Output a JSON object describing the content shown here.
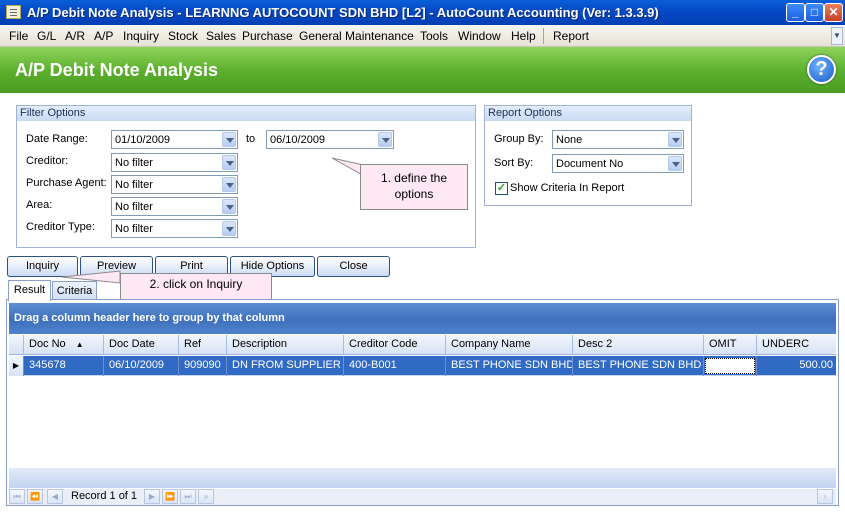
{
  "window": {
    "title": "A/P Debit Note Analysis - LEARNNG AUTOCOUNT SDN BHD [L2] - AutoCount Accounting (Ver: 1.3.3.9)",
    "minimize_glyph": "_",
    "maximize_glyph": "□",
    "close_glyph": "✕"
  },
  "menu": {
    "items": [
      "File",
      "G/L",
      "A/R",
      "A/P",
      "Inquiry",
      "Stock",
      "Sales",
      "Purchase",
      "General Maintenance",
      "Tools",
      "Window",
      "Help",
      "Report"
    ],
    "scroll_glyph": "▼"
  },
  "header": {
    "title": "A/P Debit Note Analysis",
    "help_glyph": "?"
  },
  "filter_options": {
    "title": "Filter Options",
    "date_range_label": "Date Range:",
    "date_from": "01/10/2009",
    "to_label": "to",
    "date_to": "06/10/2009",
    "creditor_label": "Creditor:",
    "creditor_value": "No filter",
    "purchase_agent_label": "Purchase Agent:",
    "purchase_agent_value": "No filter",
    "area_label": "Area:",
    "area_value": "No filter",
    "creditor_type_label": "Creditor Type:",
    "creditor_type_value": "No filter"
  },
  "report_options": {
    "title": "Report Options",
    "group_by_label": "Group By:",
    "group_by_value": "None",
    "sort_by_label": "Sort By:",
    "sort_by_value": "Document No",
    "show_criteria_label": "Show Criteria In Report",
    "show_criteria_checked": true,
    "check_glyph": "✓"
  },
  "buttons": {
    "inquiry": "Inquiry",
    "preview": "Preview",
    "print": "Print",
    "hide_options": "Hide Options",
    "close": "Close"
  },
  "callouts": {
    "define_options": "1. define the options",
    "click_inquiry": "2. click on Inquiry"
  },
  "tabs": [
    {
      "label": "Result",
      "active": true
    },
    {
      "label": "Criteria",
      "active": false
    }
  ],
  "grid": {
    "group_panel_text": "Drag a column header here to group by that column",
    "columns": [
      "Doc No",
      "Doc Date",
      "Ref",
      "Description",
      "Creditor Code",
      "Company Name",
      "Desc 2",
      "OMIT",
      "UNDERC"
    ],
    "sort_glyph": "▲",
    "row_indicator_glyph": "▶",
    "rows": [
      {
        "doc_no": "345678",
        "doc_date": "06/10/2009",
        "ref": "909090",
        "description": "DN FROM SUPPLIER",
        "creditor_code": "400-B001",
        "company_name": "BEST PHONE SDN BHD",
        "desc2": "BEST PHONE SDN BHD",
        "omit": "",
        "underc": "500.00"
      }
    ],
    "navigator": {
      "record_text": "Record 1 of 1",
      "first_glyph": "⏮",
      "prev_page_glyph": "⏪",
      "prev_glyph": "◀",
      "next_glyph": "▶",
      "next_page_glyph": "⏩",
      "last_glyph": "⏭",
      "end_glyph": "»",
      "scroll_right_glyph": "›"
    }
  },
  "colors": {
    "titlebar": "#0548c4",
    "header_green": "#59ad2c",
    "selection": "#316ac5",
    "callout_bg": "#fde8f3"
  }
}
